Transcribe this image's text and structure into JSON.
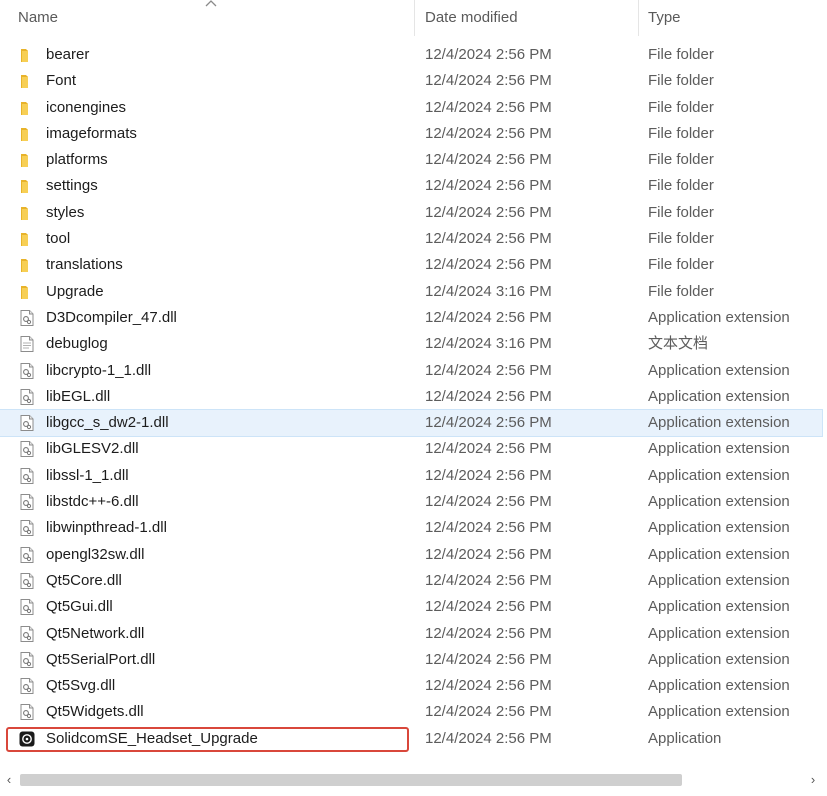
{
  "columns": {
    "name": "Name",
    "date_modified": "Date modified",
    "type": "Type"
  },
  "icons": {
    "folder": "folder-icon",
    "dll": "dll-file-icon",
    "text": "text-file-icon",
    "app": "application-icon"
  },
  "colors": {
    "folder": "#f4c542",
    "selected_row": "#e8f2fc",
    "highlight_border": "#d9473b"
  },
  "files": [
    {
      "name": "bearer",
      "date": "12/4/2024 2:56 PM",
      "type": "File folder",
      "icon": "folder"
    },
    {
      "name": "Font",
      "date": "12/4/2024 2:56 PM",
      "type": "File folder",
      "icon": "folder"
    },
    {
      "name": "iconengines",
      "date": "12/4/2024 2:56 PM",
      "type": "File folder",
      "icon": "folder"
    },
    {
      "name": "imageformats",
      "date": "12/4/2024 2:56 PM",
      "type": "File folder",
      "icon": "folder"
    },
    {
      "name": "platforms",
      "date": "12/4/2024 2:56 PM",
      "type": "File folder",
      "icon": "folder"
    },
    {
      "name": "settings",
      "date": "12/4/2024 2:56 PM",
      "type": "File folder",
      "icon": "folder"
    },
    {
      "name": "styles",
      "date": "12/4/2024 2:56 PM",
      "type": "File folder",
      "icon": "folder"
    },
    {
      "name": "tool",
      "date": "12/4/2024 2:56 PM",
      "type": "File folder",
      "icon": "folder"
    },
    {
      "name": "translations",
      "date": "12/4/2024 2:56 PM",
      "type": "File folder",
      "icon": "folder"
    },
    {
      "name": "Upgrade",
      "date": "12/4/2024 3:16 PM",
      "type": "File folder",
      "icon": "folder"
    },
    {
      "name": "D3Dcompiler_47.dll",
      "date": "12/4/2024 2:56 PM",
      "type": "Application extension",
      "icon": "dll"
    },
    {
      "name": "debuglog",
      "date": "12/4/2024 3:16 PM",
      "type": "文本文档",
      "icon": "text"
    },
    {
      "name": "libcrypto-1_1.dll",
      "date": "12/4/2024 2:56 PM",
      "type": "Application extension",
      "icon": "dll"
    },
    {
      "name": "libEGL.dll",
      "date": "12/4/2024 2:56 PM",
      "type": "Application extension",
      "icon": "dll"
    },
    {
      "name": "libgcc_s_dw2-1.dll",
      "date": "12/4/2024 2:56 PM",
      "type": "Application extension",
      "icon": "dll",
      "selected": true
    },
    {
      "name": "libGLESV2.dll",
      "date": "12/4/2024 2:56 PM",
      "type": "Application extension",
      "icon": "dll"
    },
    {
      "name": "libssl-1_1.dll",
      "date": "12/4/2024 2:56 PM",
      "type": "Application extension",
      "icon": "dll"
    },
    {
      "name": "libstdc++-6.dll",
      "date": "12/4/2024 2:56 PM",
      "type": "Application extension",
      "icon": "dll"
    },
    {
      "name": "libwinpthread-1.dll",
      "date": "12/4/2024 2:56 PM",
      "type": "Application extension",
      "icon": "dll"
    },
    {
      "name": "opengl32sw.dll",
      "date": "12/4/2024 2:56 PM",
      "type": "Application extension",
      "icon": "dll"
    },
    {
      "name": "Qt5Core.dll",
      "date": "12/4/2024 2:56 PM",
      "type": "Application extension",
      "icon": "dll"
    },
    {
      "name": "Qt5Gui.dll",
      "date": "12/4/2024 2:56 PM",
      "type": "Application extension",
      "icon": "dll"
    },
    {
      "name": "Qt5Network.dll",
      "date": "12/4/2024 2:56 PM",
      "type": "Application extension",
      "icon": "dll"
    },
    {
      "name": "Qt5SerialPort.dll",
      "date": "12/4/2024 2:56 PM",
      "type": "Application extension",
      "icon": "dll"
    },
    {
      "name": "Qt5Svg.dll",
      "date": "12/4/2024 2:56 PM",
      "type": "Application extension",
      "icon": "dll"
    },
    {
      "name": "Qt5Widgets.dll",
      "date": "12/4/2024 2:56 PM",
      "type": "Application extension",
      "icon": "dll"
    },
    {
      "name": "SolidcomSE_Headset_Upgrade",
      "date": "12/4/2024 2:56 PM",
      "type": "Application",
      "icon": "app",
      "highlighted": true
    }
  ],
  "scrollbar": {
    "left_arrow": "‹",
    "right_arrow": "›"
  }
}
